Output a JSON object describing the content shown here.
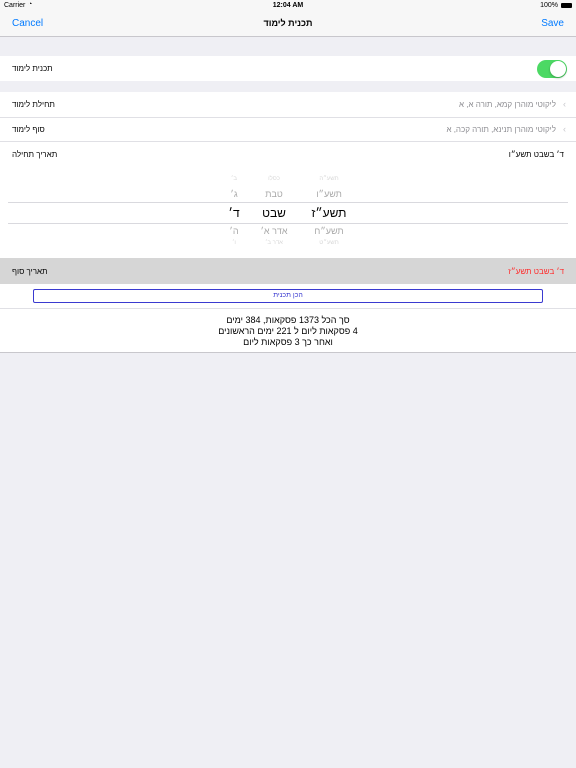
{
  "status_bar": {
    "carrier": "Carrier",
    "time": "12:04 AM",
    "battery": "100%"
  },
  "nav": {
    "cancel_label": "Cancel",
    "title": "תכנית לימוד",
    "save_label": "Save"
  },
  "plan_toggle": {
    "label": "תכנית לימוד",
    "on": true
  },
  "start_study": {
    "label": "תחילת לימוד",
    "value": "ליקוטי מוהרן קמא, תורה א, א"
  },
  "end_study": {
    "label": "סוף לימוד",
    "value": "ליקוטי מוהרן תנינא, תורה קכה, א"
  },
  "start_date": {
    "label": "תאריך תחילה",
    "value": "ד׳ בשבט תשע״ו"
  },
  "picker": {
    "day": [
      "ב׳",
      "ג׳",
      "ד׳",
      "ה׳",
      "ו׳"
    ],
    "month": [
      "כסלו",
      "טבת",
      "שבט",
      "אדר א׳",
      "אדר ב׳"
    ],
    "year": [
      "תשע״ה",
      "תשע״ו",
      "תשע״ז",
      "תשע״ח",
      "תשע״ט"
    ]
  },
  "end_date": {
    "label": "תאריך סוף",
    "value": "ד׳ בשבט תשע״ז",
    "value_color": "#ff2a2a"
  },
  "prep_button_label": "הכן תכנית",
  "summary": [
    "סך הכל 1373 פסקאות, 384 ימים",
    "4 פסקאות ליום  ל 221 ימים הראשונים",
    "ואחר כך 3 פסקאות ליום"
  ],
  "colors": {
    "accent": "#007aff",
    "toggle_on": "#4cd964",
    "button_border": "#3a3ad0"
  }
}
